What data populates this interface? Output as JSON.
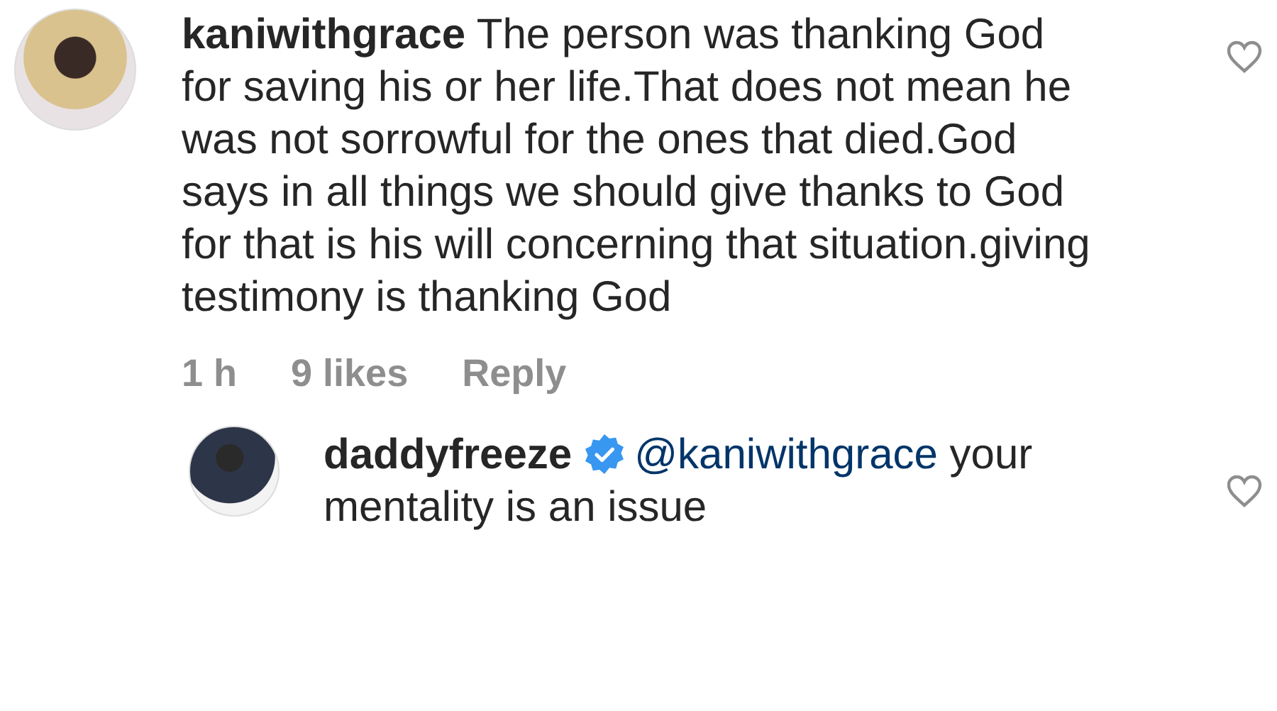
{
  "comments": [
    {
      "kind": "comment",
      "username": "kaniwithgrace",
      "verified": false,
      "text": "The person was thanking God for saving his or her life.That does not mean he was not sorrowful for the ones that died.God says in all things we should give thanks to God for that is his will concerning that situation.giving testimony is thanking God",
      "time": "1 h",
      "likes": "9 likes",
      "reply": "Reply",
      "liked": false
    },
    {
      "kind": "reply",
      "username": "daddyfreeze",
      "verified": true,
      "mention": "@kaniwithgrace",
      "text": "your mentality is an issue",
      "liked": false
    }
  ]
}
